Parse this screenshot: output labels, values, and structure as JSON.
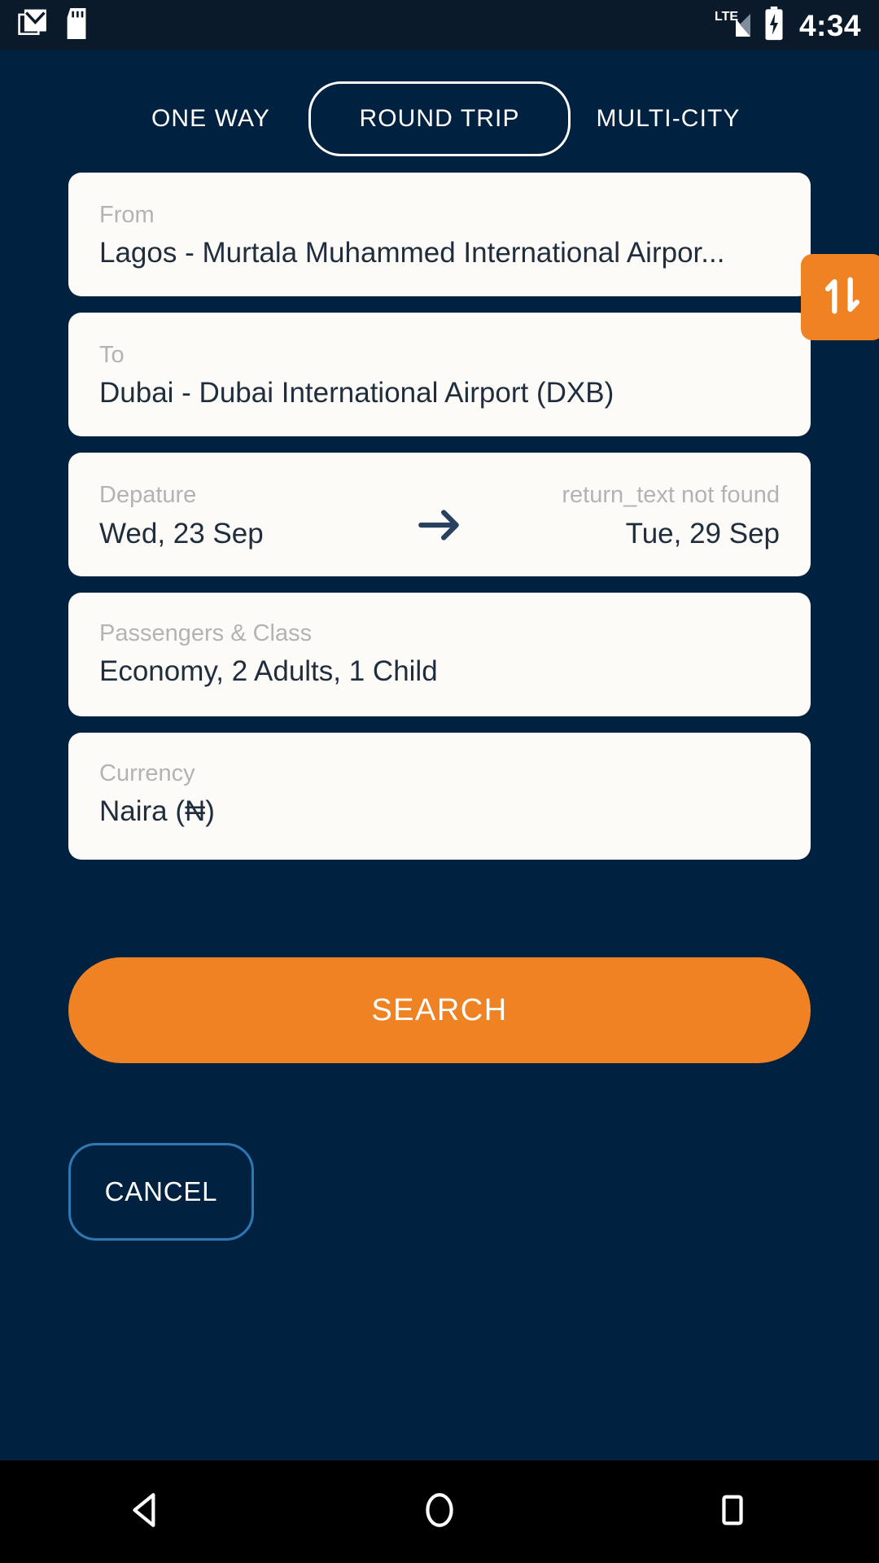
{
  "status_bar": {
    "icons": [
      "gmail-icon",
      "sd-card-icon"
    ],
    "network_label": "LTE",
    "signal_icon": "signal-bars-icon",
    "battery_icon": "battery-charging-icon",
    "time": "4:34"
  },
  "tabs": [
    {
      "label": "ONE WAY",
      "selected": false
    },
    {
      "label": "ROUND TRIP",
      "selected": true
    },
    {
      "label": "MULTI-CITY",
      "selected": false
    }
  ],
  "form": {
    "from": {
      "label": "From",
      "value": "Lagos - Murtala Muhammed International Airpor..."
    },
    "to": {
      "label": "To",
      "value": "Dubai - Dubai International Airport (DXB)"
    },
    "swap_icon": "swap-vertical-icon",
    "departure": {
      "label": "Depature",
      "value": "Wed, 23 Sep"
    },
    "date_arrow_icon": "arrow-right-icon",
    "return": {
      "label": "return_text not found",
      "value": "Tue, 29 Sep"
    },
    "passengers": {
      "label": "Passengers & Class",
      "value": "Economy,  2 Adults, 1 Child"
    },
    "currency": {
      "label": "Currency",
      "value": "Naira (₦)"
    }
  },
  "actions": {
    "search_label": "SEARCH",
    "cancel_label": "CANCEL"
  },
  "nav_bar": {
    "back_icon": "back-triangle-icon",
    "home_icon": "home-circle-icon",
    "recents_icon": "recents-square-icon"
  },
  "colors": {
    "background": "#00213f",
    "card": "#fdfbf8",
    "accent_orange": "#ef8324",
    "cancel_border": "#2e79b5",
    "label_grey": "#b3b3b3",
    "value_navy": "#1f2d3d"
  }
}
